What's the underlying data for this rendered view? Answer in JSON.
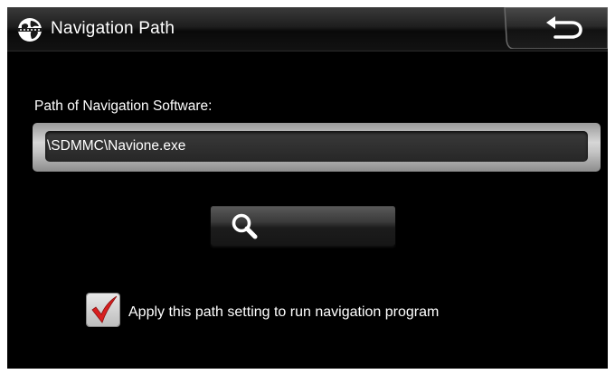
{
  "window": {
    "title": "Navigation Path",
    "title_icon": "globe-icon",
    "back_icon": "back-arrow-icon"
  },
  "path_setting": {
    "label": "Path of Navigation Software:",
    "value": "\\SDMMC\\Navione.exe"
  },
  "search_button": {
    "icon": "search-icon"
  },
  "apply_option": {
    "checked": true,
    "label": "Apply this path setting to run navigation program"
  },
  "colors": {
    "background": "#000000",
    "text": "#ffffff",
    "check_mark": "#d81f1f"
  }
}
